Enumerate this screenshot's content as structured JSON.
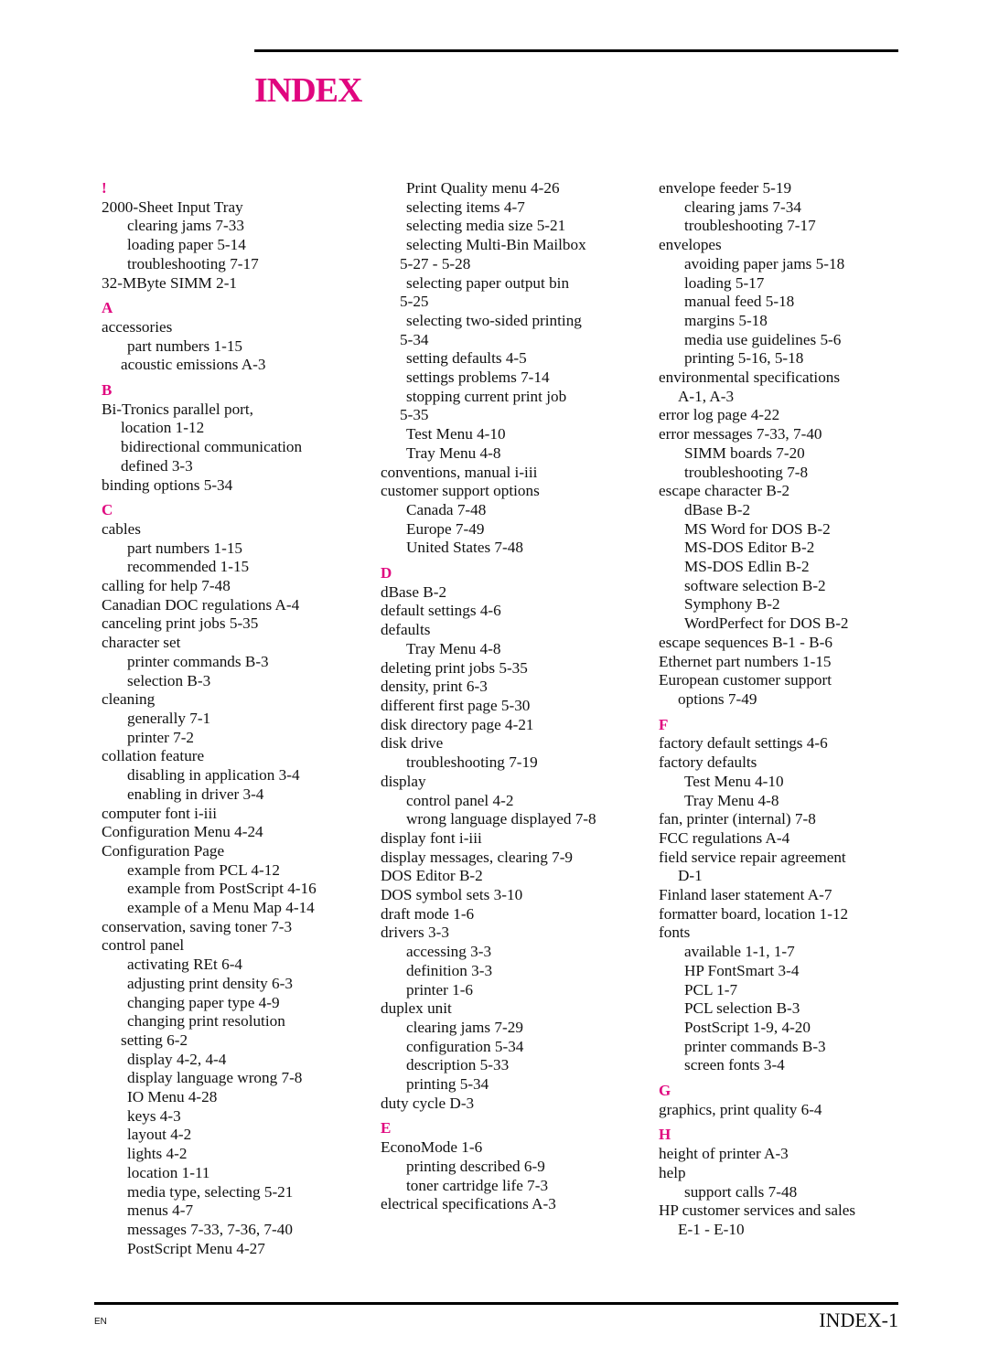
{
  "header": {
    "title": "INDEX",
    "accent_color": "#e0067f"
  },
  "columns": [
    [
      {
        "type": "letter",
        "text": "!"
      },
      {
        "lvl": 0,
        "text": "2000-Sheet Input Tray"
      },
      {
        "lvl": 1,
        "text": "clearing jams  7-33"
      },
      {
        "lvl": 1,
        "text": "loading paper  5-14"
      },
      {
        "lvl": 1,
        "text": "troubleshooting  7-17"
      },
      {
        "lvl": 0,
        "text": "32-MByte SIMM  2-1"
      },
      {
        "type": "letter",
        "text": "A"
      },
      {
        "lvl": 0,
        "text": "accessories"
      },
      {
        "lvl": 1,
        "text": "part numbers  1-15"
      },
      {
        "lvl": "c",
        "text": "acoustic emissions  A-3"
      },
      {
        "type": "letter",
        "text": "B"
      },
      {
        "lvl": 0,
        "text": "Bi-Tronics parallel port,"
      },
      {
        "lvl": "c",
        "text": "location  1-12"
      },
      {
        "lvl": "c",
        "text": "bidirectional communication"
      },
      {
        "lvl": "c",
        "text": "defined  3-3"
      },
      {
        "lvl": 0,
        "text": "binding options  5-34"
      },
      {
        "type": "letter",
        "text": "C"
      },
      {
        "lvl": 0,
        "text": "cables"
      },
      {
        "lvl": 1,
        "text": "part numbers  1-15"
      },
      {
        "lvl": 1,
        "text": "recommended  1-15"
      },
      {
        "lvl": 0,
        "text": "calling for help  7-48"
      },
      {
        "lvl": 0,
        "text": "Canadian DOC regulations  A-4"
      },
      {
        "lvl": 0,
        "text": "canceling print jobs  5-35"
      },
      {
        "lvl": 0,
        "text": "character set"
      },
      {
        "lvl": 1,
        "text": "printer commands  B-3"
      },
      {
        "lvl": 1,
        "text": "selection  B-3"
      },
      {
        "lvl": 0,
        "text": "cleaning"
      },
      {
        "lvl": 1,
        "text": "generally  7-1"
      },
      {
        "lvl": 1,
        "text": "printer  7-2"
      },
      {
        "lvl": 0,
        "text": "collation feature"
      },
      {
        "lvl": 1,
        "text": "disabling in application  3-4"
      },
      {
        "lvl": 1,
        "text": "enabling in driver  3-4"
      },
      {
        "lvl": 0,
        "text": "computer font  i-iii"
      },
      {
        "lvl": 0,
        "text": "Configuration Menu  4-24"
      },
      {
        "lvl": 0,
        "text": "Configuration Page"
      },
      {
        "lvl": 1,
        "text": "example from PCL  4-12"
      },
      {
        "lvl": 1,
        "text": "example from PostScript  4-16"
      },
      {
        "lvl": 1,
        "text": "example of a Menu Map  4-14"
      },
      {
        "lvl": 0,
        "text": "conservation, saving toner  7-3"
      },
      {
        "lvl": 0,
        "text": "control panel"
      },
      {
        "lvl": 1,
        "text": "activating REt  6-4"
      },
      {
        "lvl": 1,
        "text": "adjusting print density  6-3"
      },
      {
        "lvl": 1,
        "text": "changing paper type  4-9"
      },
      {
        "lvl": 1,
        "text": "changing print resolution"
      },
      {
        "lvl": "c",
        "text": "setting  6-2"
      },
      {
        "lvl": 1,
        "text": "display  4-2, 4-4"
      },
      {
        "lvl": 1,
        "text": "display language wrong  7-8"
      },
      {
        "lvl": 1,
        "text": "IO Menu  4-28"
      },
      {
        "lvl": 1,
        "text": "keys  4-3"
      },
      {
        "lvl": 1,
        "text": "layout  4-2"
      },
      {
        "lvl": 1,
        "text": "lights  4-2"
      },
      {
        "lvl": 1,
        "text": "location  1-11"
      },
      {
        "lvl": 1,
        "text": "media type, selecting  5-21"
      },
      {
        "lvl": 1,
        "text": "menus  4-7"
      },
      {
        "lvl": 1,
        "text": "messages  7-33, 7-36, 7-40"
      },
      {
        "lvl": 1,
        "text": "PostScript Menu  4-27"
      }
    ],
    [
      {
        "lvl": 1,
        "text": "Print Quality menu  4-26"
      },
      {
        "lvl": 1,
        "text": "selecting items  4-7"
      },
      {
        "lvl": 1,
        "text": "selecting media size  5-21"
      },
      {
        "lvl": 1,
        "text": "selecting Multi-Bin Mailbox"
      },
      {
        "lvl": "c",
        "text": "5-27 - 5-28"
      },
      {
        "lvl": 1,
        "text": "selecting paper output bin"
      },
      {
        "lvl": "c",
        "text": "5-25"
      },
      {
        "lvl": 1,
        "text": "selecting two-sided printing"
      },
      {
        "lvl": "c",
        "text": "5-34"
      },
      {
        "lvl": 1,
        "text": "setting defaults  4-5"
      },
      {
        "lvl": 1,
        "text": "settings problems  7-14"
      },
      {
        "lvl": 1,
        "text": "stopping current print job"
      },
      {
        "lvl": "c",
        "text": "5-35"
      },
      {
        "lvl": 1,
        "text": "Test Menu  4-10"
      },
      {
        "lvl": 1,
        "text": "Tray Menu  4-8"
      },
      {
        "lvl": 0,
        "text": "conventions, manual  i-iii"
      },
      {
        "lvl": 0,
        "text": "customer support options"
      },
      {
        "lvl": 1,
        "text": "Canada  7-48"
      },
      {
        "lvl": 1,
        "text": "Europe  7-49"
      },
      {
        "lvl": 1,
        "text": "United States  7-48"
      },
      {
        "type": "letter",
        "text": "D"
      },
      {
        "lvl": 0,
        "text": "dBase  B-2"
      },
      {
        "lvl": 0,
        "text": "default settings  4-6"
      },
      {
        "lvl": 0,
        "text": "defaults"
      },
      {
        "lvl": 1,
        "text": "Tray Menu  4-8"
      },
      {
        "lvl": 0,
        "text": "deleting print jobs  5-35"
      },
      {
        "lvl": 0,
        "text": "density, print  6-3"
      },
      {
        "lvl": 0,
        "text": "different first page  5-30"
      },
      {
        "lvl": 0,
        "text": "disk directory page  4-21"
      },
      {
        "lvl": 0,
        "text": "disk drive"
      },
      {
        "lvl": 1,
        "text": "troubleshooting  7-19"
      },
      {
        "lvl": 0,
        "text": "display"
      },
      {
        "lvl": 1,
        "text": "control panel  4-2"
      },
      {
        "lvl": 1,
        "text": "wrong language displayed  7-8"
      },
      {
        "lvl": 0,
        "text": "display font  i-iii"
      },
      {
        "lvl": 0,
        "text": "display messages, clearing  7-9"
      },
      {
        "lvl": 0,
        "text": "DOS Editor  B-2"
      },
      {
        "lvl": 0,
        "text": "DOS symbol sets  3-10"
      },
      {
        "lvl": 0,
        "text": "draft mode  1-6"
      },
      {
        "lvl": 0,
        "text": "drivers  3-3"
      },
      {
        "lvl": 1,
        "text": "accessing  3-3"
      },
      {
        "lvl": 1,
        "text": "definition  3-3"
      },
      {
        "lvl": 1,
        "text": "printer  1-6"
      },
      {
        "lvl": 0,
        "text": "duplex unit"
      },
      {
        "lvl": 1,
        "text": "clearing jams  7-29"
      },
      {
        "lvl": 1,
        "text": "configuration  5-34"
      },
      {
        "lvl": 1,
        "text": "description  5-33"
      },
      {
        "lvl": 1,
        "text": "printing  5-34"
      },
      {
        "lvl": 0,
        "text": "duty cycle  D-3"
      },
      {
        "type": "letter",
        "text": "E"
      },
      {
        "lvl": 0,
        "text": "EconoMode  1-6"
      },
      {
        "lvl": 1,
        "text": "printing described  6-9"
      },
      {
        "lvl": 1,
        "text": "toner cartridge life  7-3"
      },
      {
        "lvl": 0,
        "text": "electrical specifications  A-3"
      }
    ],
    [
      {
        "lvl": 0,
        "text": "envelope feeder  5-19"
      },
      {
        "lvl": 1,
        "text": "clearing jams  7-34"
      },
      {
        "lvl": 1,
        "text": "troubleshooting  7-17"
      },
      {
        "lvl": 0,
        "text": "envelopes"
      },
      {
        "lvl": 1,
        "text": "avoiding paper jams  5-18"
      },
      {
        "lvl": 1,
        "text": "loading  5-17"
      },
      {
        "lvl": 1,
        "text": "manual feed  5-18"
      },
      {
        "lvl": 1,
        "text": "margins  5-18"
      },
      {
        "lvl": 1,
        "text": "media use guidelines  5-6"
      },
      {
        "lvl": 1,
        "text": "printing  5-16, 5-18"
      },
      {
        "lvl": 0,
        "text": "environmental specifications"
      },
      {
        "lvl": "c",
        "text": "A-1, A-3"
      },
      {
        "lvl": 0,
        "text": "error log page  4-22"
      },
      {
        "lvl": 0,
        "text": "error messages  7-33, 7-40"
      },
      {
        "lvl": 1,
        "text": "SIMM boards  7-20"
      },
      {
        "lvl": 1,
        "text": "troubleshooting  7-8"
      },
      {
        "lvl": 0,
        "text": "escape character  B-2"
      },
      {
        "lvl": 1,
        "text": "dBase  B-2"
      },
      {
        "lvl": 1,
        "text": "MS Word for DOS  B-2"
      },
      {
        "lvl": 1,
        "text": "MS-DOS Editor  B-2"
      },
      {
        "lvl": 1,
        "text": "MS-DOS Edlin  B-2"
      },
      {
        "lvl": 1,
        "text": "software selection  B-2"
      },
      {
        "lvl": 1,
        "text": "Symphony  B-2"
      },
      {
        "lvl": 1,
        "text": "WordPerfect for DOS  B-2"
      },
      {
        "lvl": 0,
        "text": "escape sequences  B-1 - B-6"
      },
      {
        "lvl": 0,
        "text": "Ethernet part numbers  1-15"
      },
      {
        "lvl": 0,
        "text": "European customer support"
      },
      {
        "lvl": "c",
        "text": "options  7-49"
      },
      {
        "type": "letter",
        "text": "F"
      },
      {
        "lvl": 0,
        "text": "factory default settings  4-6"
      },
      {
        "lvl": 0,
        "text": "factory defaults"
      },
      {
        "lvl": 1,
        "text": "Test Menu  4-10"
      },
      {
        "lvl": 1,
        "text": "Tray Menu  4-8"
      },
      {
        "lvl": 0,
        "text": "fan, printer (internal)  7-8"
      },
      {
        "lvl": 0,
        "text": "FCC regulations  A-4"
      },
      {
        "lvl": 0,
        "text": "field service repair agreement"
      },
      {
        "lvl": "c",
        "text": "D-1"
      },
      {
        "lvl": 0,
        "text": "Finland laser statement  A-7"
      },
      {
        "lvl": 0,
        "text": "formatter board, location  1-12"
      },
      {
        "lvl": 0,
        "text": "fonts"
      },
      {
        "lvl": 1,
        "text": "available  1-1, 1-7"
      },
      {
        "lvl": 1,
        "text": "HP FontSmart  3-4"
      },
      {
        "lvl": 1,
        "text": "PCL  1-7"
      },
      {
        "lvl": 1,
        "text": "PCL selection  B-3"
      },
      {
        "lvl": 1,
        "text": "PostScript  1-9, 4-20"
      },
      {
        "lvl": 1,
        "text": "printer commands  B-3"
      },
      {
        "lvl": 1,
        "text": "screen fonts  3-4"
      },
      {
        "type": "letter",
        "text": "G"
      },
      {
        "lvl": 0,
        "text": "graphics, print quality  6-4"
      },
      {
        "type": "letter",
        "text": "H"
      },
      {
        "lvl": 0,
        "text": "height of printer  A-3"
      },
      {
        "lvl": 0,
        "text": "help"
      },
      {
        "lvl": 1,
        "text": "support calls  7-48"
      },
      {
        "lvl": 0,
        "text": "HP customer services and sales"
      },
      {
        "lvl": "c",
        "text": "E-1 - E-10"
      }
    ]
  ],
  "footer": {
    "language": "EN",
    "page_number": "INDEX-1"
  }
}
